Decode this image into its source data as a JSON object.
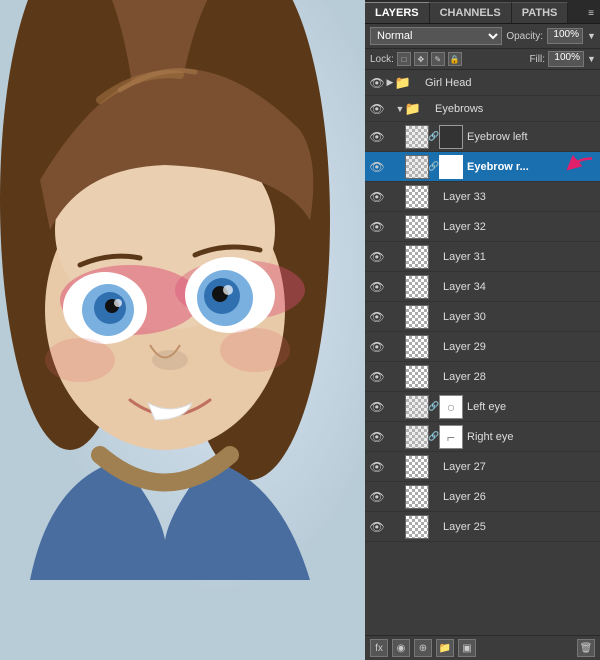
{
  "tabs": [
    {
      "label": "LAYERS",
      "active": true
    },
    {
      "label": "CHANNELS",
      "active": false
    },
    {
      "label": "PATHS",
      "active": false
    }
  ],
  "blend_mode": "Normal",
  "opacity_label": "Opacity:",
  "opacity_value": "100%",
  "lock_label": "Lock:",
  "fill_label": "Fill:",
  "fill_value": "100%",
  "layers": [
    {
      "id": "girl-head",
      "name": "Girl Head",
      "type": "group",
      "indent": 0,
      "visible": true,
      "expanded": true,
      "selected": false
    },
    {
      "id": "eyebrows",
      "name": "Eyebrows",
      "type": "group",
      "indent": 1,
      "visible": true,
      "expanded": true,
      "selected": false
    },
    {
      "id": "eyebrow-left",
      "name": "Eyebrow left",
      "type": "layer",
      "indent": 2,
      "visible": true,
      "selected": false,
      "has_mask": true,
      "has_chain": true
    },
    {
      "id": "eyebrow-right",
      "name": "Eyebrow r...",
      "type": "layer",
      "indent": 2,
      "visible": true,
      "selected": true,
      "has_mask": true,
      "has_chain": true,
      "has_arrow": true
    },
    {
      "id": "layer33",
      "name": "Layer 33",
      "type": "layer",
      "indent": 1,
      "visible": true,
      "selected": false
    },
    {
      "id": "layer32",
      "name": "Layer 32",
      "type": "layer",
      "indent": 1,
      "visible": true,
      "selected": false
    },
    {
      "id": "layer31",
      "name": "Layer 31",
      "type": "layer",
      "indent": 1,
      "visible": true,
      "selected": false
    },
    {
      "id": "layer34",
      "name": "Layer 34",
      "type": "layer",
      "indent": 1,
      "visible": true,
      "selected": false
    },
    {
      "id": "layer30",
      "name": "Layer 30",
      "type": "layer",
      "indent": 1,
      "visible": true,
      "selected": false
    },
    {
      "id": "layer29",
      "name": "Layer 29",
      "type": "layer",
      "indent": 1,
      "visible": true,
      "selected": false
    },
    {
      "id": "layer28",
      "name": "Layer 28",
      "type": "layer",
      "indent": 1,
      "visible": true,
      "selected": false
    },
    {
      "id": "left-eye",
      "name": "Left eye",
      "type": "layer",
      "indent": 1,
      "visible": true,
      "selected": false,
      "has_mask": true,
      "has_chain": true
    },
    {
      "id": "right-eye",
      "name": "Right eye",
      "type": "layer",
      "indent": 1,
      "visible": true,
      "selected": false,
      "has_mask": true,
      "has_chain": true
    },
    {
      "id": "layer27",
      "name": "Layer 27",
      "type": "layer",
      "indent": 1,
      "visible": true,
      "selected": false
    },
    {
      "id": "layer26",
      "name": "Layer 26",
      "type": "layer",
      "indent": 1,
      "visible": true,
      "selected": false
    },
    {
      "id": "layer25",
      "name": "Layer 25",
      "type": "layer",
      "indent": 1,
      "visible": true,
      "selected": false
    }
  ],
  "lock_icons": [
    "□",
    "✥",
    "✎",
    "🔒"
  ],
  "bottom_buttons": [
    "fx",
    "◉",
    "▣",
    "📁",
    "🗑"
  ]
}
